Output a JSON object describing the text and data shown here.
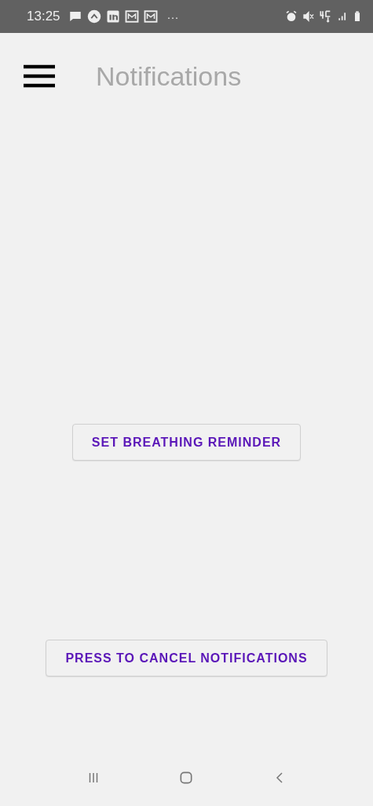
{
  "status_bar": {
    "time": "13:25",
    "more": "···"
  },
  "app_bar": {
    "title": "Notifications"
  },
  "buttons": [
    {
      "label": "SET BREATHING REMINDER"
    },
    {
      "label": "PRESS TO CANCEL NOTIFICATIONS"
    }
  ]
}
